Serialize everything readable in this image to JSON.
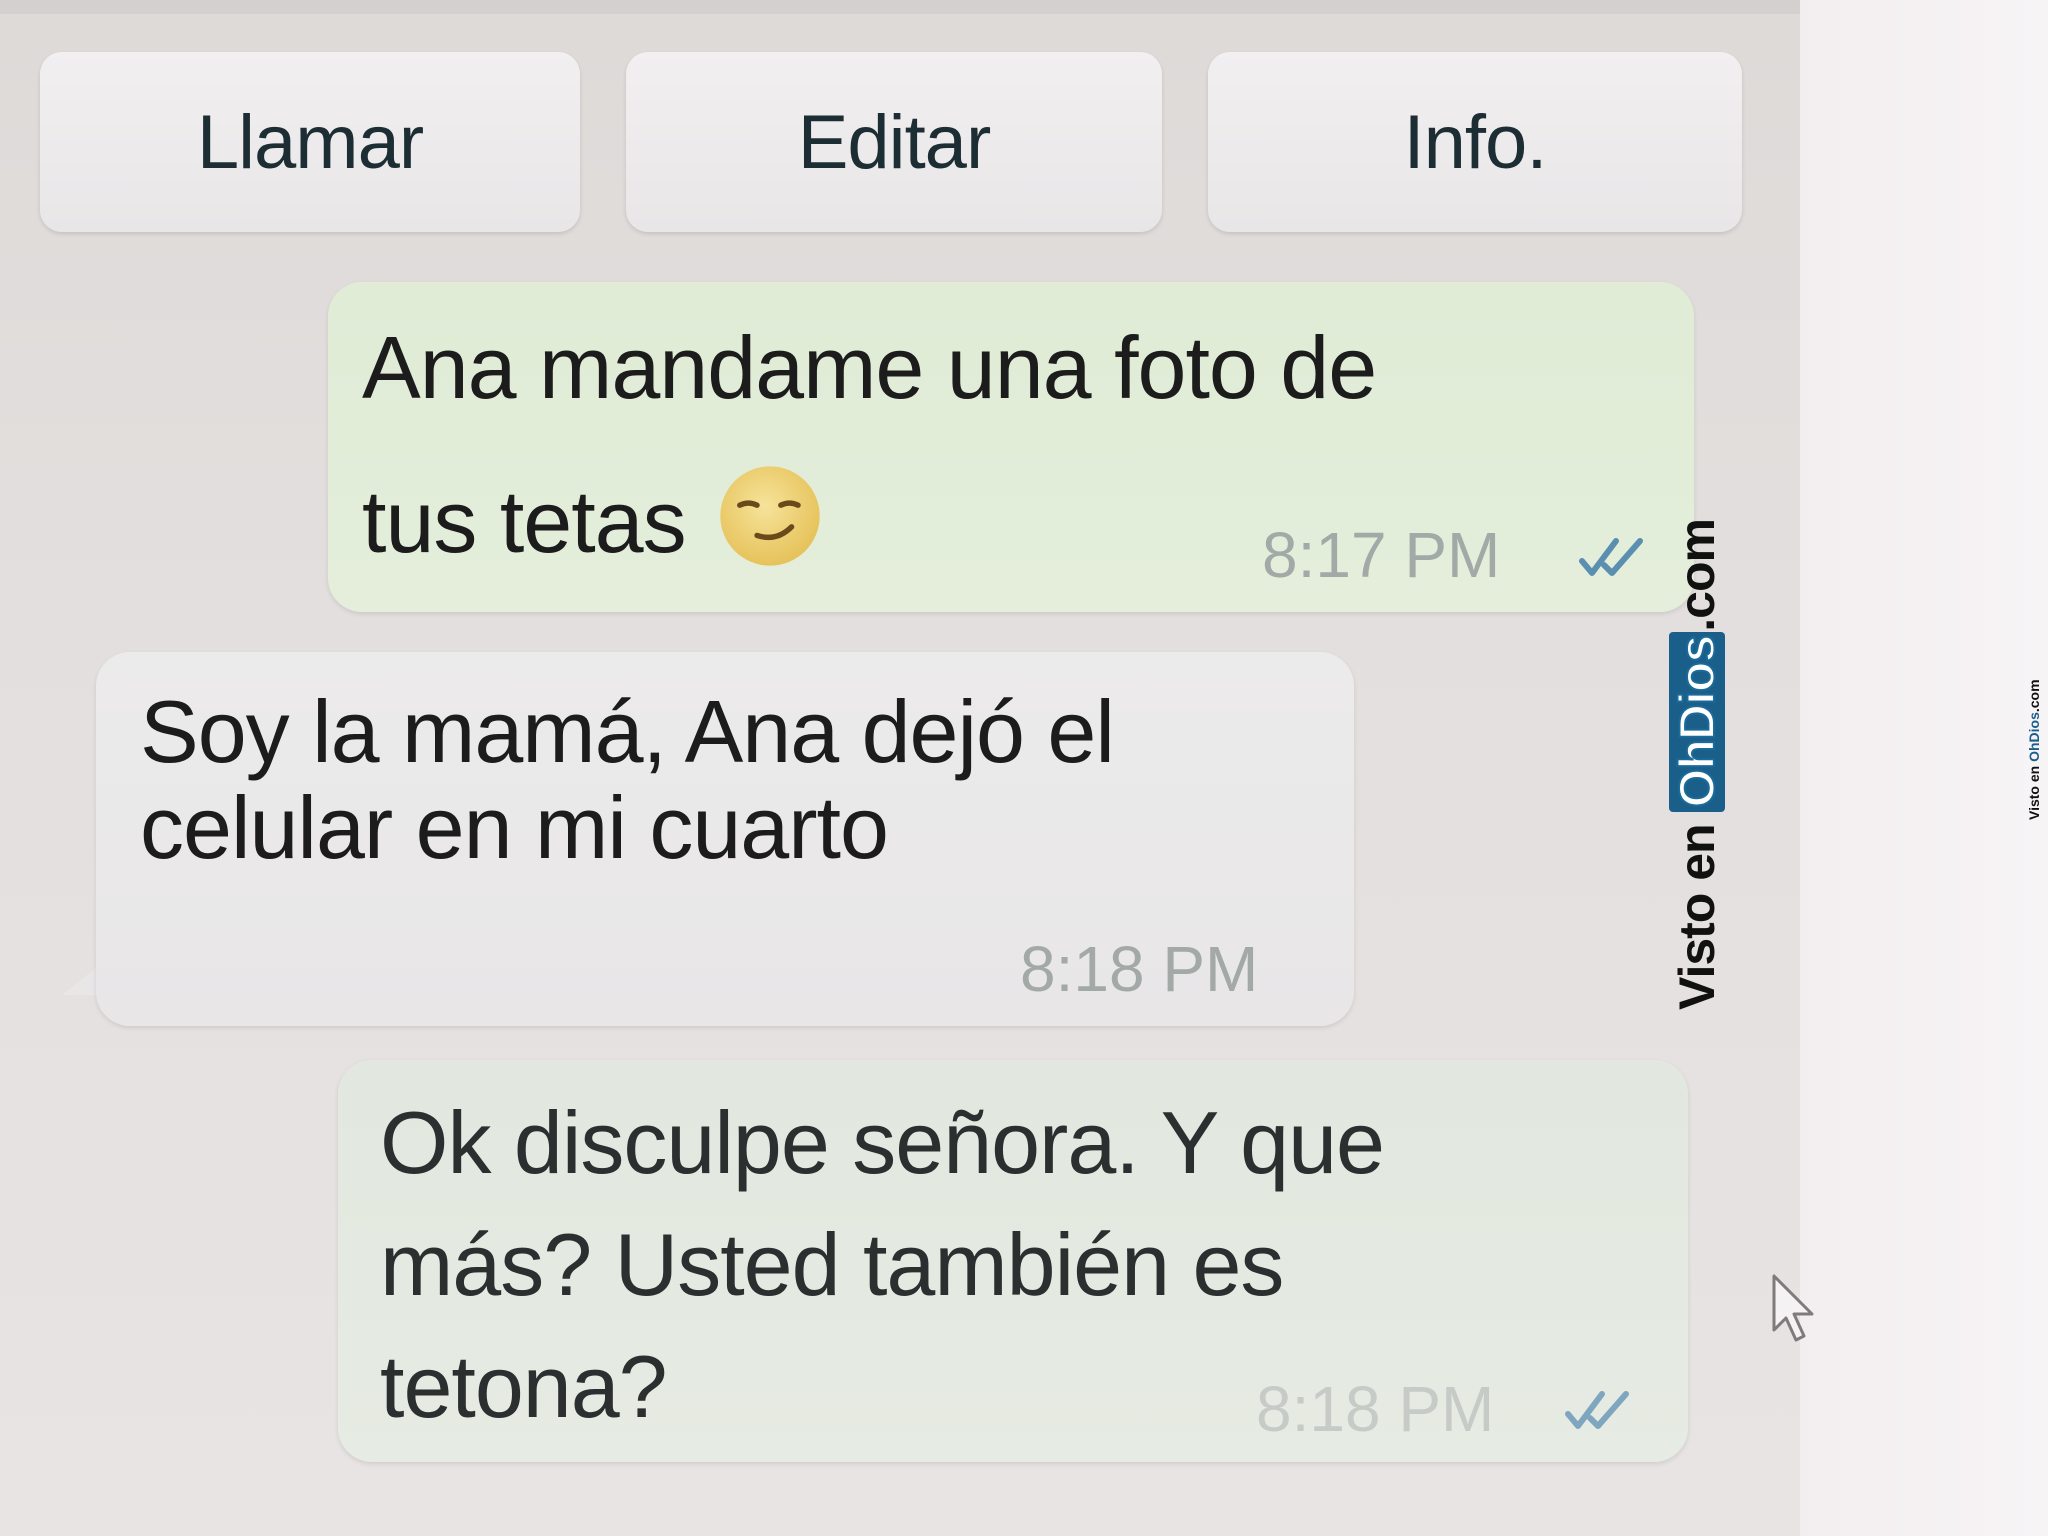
{
  "toolbar": {
    "call_label": "Llamar",
    "edit_label": "Editar",
    "info_label": "Info."
  },
  "messages": [
    {
      "direction": "outgoing",
      "line1": "Ana mandame una foto de",
      "line2": "tus tetas",
      "emoji": "smirking-face-icon",
      "time": "8:17 PM",
      "status": "read-double-check"
    },
    {
      "direction": "incoming",
      "line1": "Soy la mamá, Ana dejó el",
      "line2": "celular en mi cuarto",
      "time": "8:18 PM"
    },
    {
      "direction": "outgoing",
      "line1": "Ok disculpe señora. Y que",
      "line2": "más? Usted también es",
      "line3": "tetona?",
      "time": "8:18 PM",
      "status": "read-double-check"
    }
  ],
  "watermark": {
    "prefix": "Visto en ",
    "brand": "OhDios",
    "suffix": ".com"
  },
  "colors": {
    "outgoing_bubble": "#e0ecd6",
    "incoming_bubble": "#ecebeb",
    "read_check": "#5b8fb0",
    "timestamp": "#a3a9a6"
  }
}
